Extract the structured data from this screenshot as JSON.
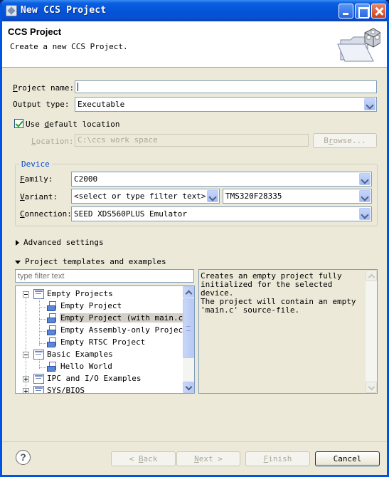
{
  "window": {
    "title": "New CCS Project"
  },
  "header": {
    "title": "CCS Project",
    "description": "Create a new CCS Project."
  },
  "project_name": {
    "label_pre": "",
    "label_u": "P",
    "label_post": "roject name:",
    "value": ""
  },
  "output_type": {
    "label": "Output type:",
    "value": "Executable"
  },
  "use_default_location": {
    "label_pre": "Use ",
    "label_u": "d",
    "label_post": "efault location",
    "checked": true
  },
  "location": {
    "label_pre": "",
    "label_u": "L",
    "label_post": "ocation:",
    "value": "C:\\ccs work space",
    "browse_label_pre": "B",
    "browse_label_u": "r",
    "browse_label_post": "owse..."
  },
  "device": {
    "group_title": "Device",
    "family": {
      "label_pre": "",
      "label_u": "F",
      "label_post": "amily:",
      "value": "C2000"
    },
    "variant": {
      "label_pre": "",
      "label_u": "V",
      "label_post": "ariant:",
      "filter_value": "<select or type filter text>",
      "value": "TMS320F28335"
    },
    "connection": {
      "label_pre": "",
      "label_u": "C",
      "label_post": "onnection:",
      "value": "SEED XDS560PLUS Emulator"
    }
  },
  "advanced_settings": {
    "label": "Advanced settings",
    "expanded": false
  },
  "templates": {
    "label": "Project templates and examples",
    "expanded": true,
    "filter_placeholder": "type filter text",
    "tree": {
      "empty_projects": "Empty Projects",
      "empty_project": "Empty Project",
      "empty_project_main": "Empty Project (with main.c)",
      "empty_assembly": "Empty Assembly-only Project",
      "empty_rtsc": "Empty RTSC Project",
      "basic_examples": "Basic Examples",
      "hello_world": "Hello World",
      "ipc_io": "IPC and I/O Examples",
      "sys_bios": "SYS/BIOS"
    },
    "description": "Creates an empty project fully\ninitialized for the selected device.\nThe project will contain an empty\n'main.c' source-file."
  },
  "footer": {
    "back": {
      "pre": "< ",
      "u": "B",
      "post": "ack"
    },
    "next": {
      "pre": "",
      "u": "N",
      "post": "ext >"
    },
    "finish": {
      "pre": "",
      "u": "F",
      "post": "inish"
    },
    "cancel": "Cancel"
  },
  "colors": {
    "titlebar": "#0453d8",
    "dialog_bg": "#ece9d8",
    "group_title": "#0046d5",
    "field_border": "#7f9db9"
  },
  "icons": [
    "ccs-app-icon",
    "minimize-icon",
    "maximize-icon",
    "close-icon",
    "wizard-folder-icon",
    "checkbox-icon",
    "dropdown-arrow-icon",
    "expand-triangle-icon",
    "folder-icon",
    "project-icon",
    "help-icon"
  ]
}
